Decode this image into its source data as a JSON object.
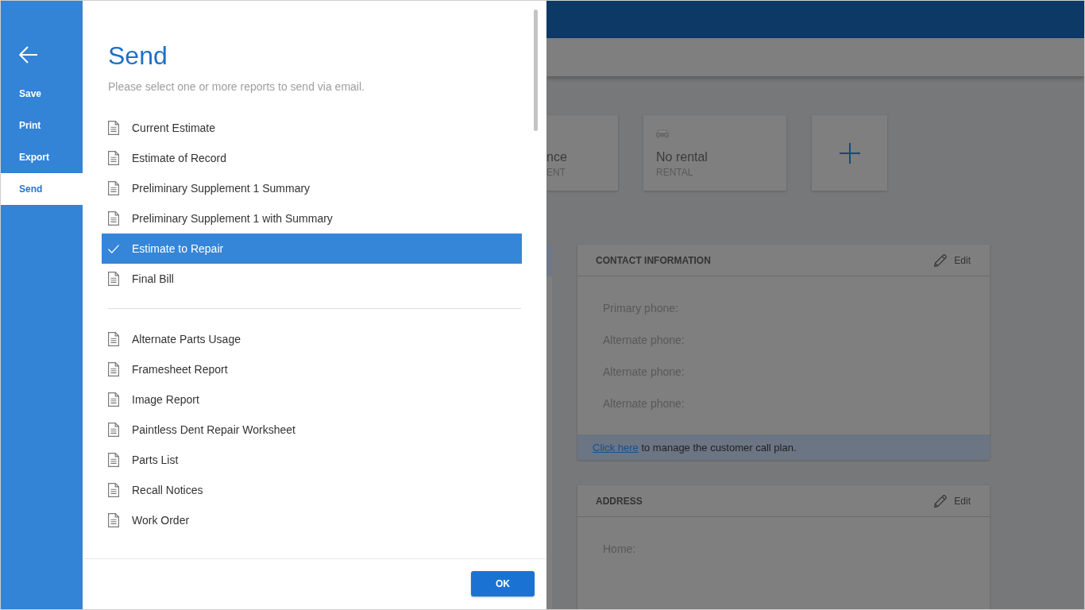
{
  "sidebar": {
    "items": [
      {
        "label": "Save",
        "selected": false
      },
      {
        "label": "Print",
        "selected": false
      },
      {
        "label": "Export",
        "selected": false
      },
      {
        "label": "Send",
        "selected": true
      }
    ]
  },
  "send_dialog": {
    "title": "Send",
    "subtitle": "Please select one or more reports to send via email.",
    "report_groups": [
      {
        "reports": [
          {
            "label": "Current Estimate",
            "selected": false
          },
          {
            "label": "Estimate of Record",
            "selected": false
          },
          {
            "label": "Preliminary Supplement 1 Summary",
            "selected": false
          },
          {
            "label": "Preliminary Supplement 1 with Summary",
            "selected": false
          },
          {
            "label": "Estimate to Repair",
            "selected": true
          },
          {
            "label": "Final Bill",
            "selected": false
          }
        ]
      },
      {
        "reports": [
          {
            "label": "Alternate Parts Usage",
            "selected": false
          },
          {
            "label": "Framesheet Report",
            "selected": false
          },
          {
            "label": "Image Report",
            "selected": false
          },
          {
            "label": "Paintless Dent Repair Worksheet",
            "selected": false
          },
          {
            "label": "Parts List",
            "selected": false
          },
          {
            "label": "Recall Notices",
            "selected": false
          },
          {
            "label": "Work Order",
            "selected": false
          }
        ]
      }
    ],
    "ok_button": "OK"
  },
  "background": {
    "cards": [
      {
        "kind": "clipped",
        "title": "nce",
        "caption": "ENT"
      },
      {
        "kind": "summary",
        "title": "No rental",
        "caption": "RENTAL"
      },
      {
        "kind": "add"
      }
    ],
    "panels": [
      {
        "title": "CONTACT INFORMATION",
        "edit": "Edit",
        "fields": [
          "Primary phone:",
          "Alternate phone:",
          "Alternate phone:",
          "Alternate phone:"
        ],
        "footer": {
          "link": "Click here",
          "text": "to manage the customer call plan."
        }
      },
      {
        "title": "ADDRESS",
        "edit": "Edit",
        "fields": [
          "Home:"
        ]
      }
    ]
  }
}
